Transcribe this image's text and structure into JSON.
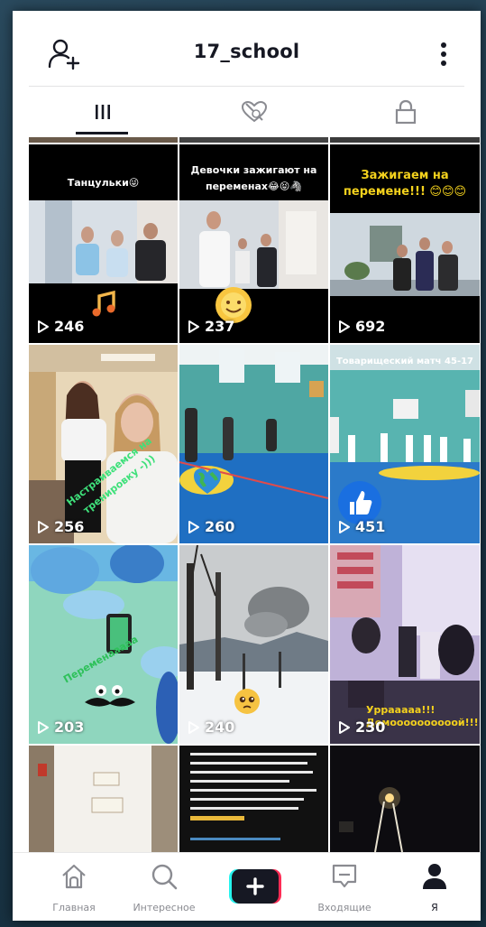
{
  "header": {
    "title": "17_school",
    "add_user_icon": "person-plus-icon",
    "more_icon": "vertical-dots-icon"
  },
  "tabs": [
    {
      "id": "videos",
      "icon": "grid-lines-icon",
      "active": true
    },
    {
      "id": "liked",
      "icon": "heart-hidden-icon",
      "active": false
    },
    {
      "id": "private",
      "icon": "lock-icon",
      "active": false
    }
  ],
  "videos": [
    {
      "views": "246",
      "caption": "Танцульки😜"
    },
    {
      "views": "237",
      "caption": "Девочки зажигают на переменах😂😝🦓"
    },
    {
      "views": "692",
      "caption": "Зажигаем на перемене!!! 😊😊😊"
    },
    {
      "views": "256",
      "caption": "Настраиваемся на тренировку -)))"
    },
    {
      "views": "260",
      "caption": ""
    },
    {
      "views": "451",
      "caption": "Товарищеский матч 45-17"
    },
    {
      "views": "203",
      "caption": "Переменааааа"
    },
    {
      "views": "240",
      "caption": ""
    },
    {
      "views": "230",
      "caption": "Уррааааа!!! Домоооооооооой!!!!!"
    },
    {
      "views": "",
      "caption": ""
    },
    {
      "views": "",
      "caption": ""
    },
    {
      "views": "",
      "caption": ""
    }
  ],
  "nav": {
    "home": "Главная",
    "discover": "Интересное",
    "inbox": "Входящие",
    "me": "Я"
  },
  "colors": {
    "accent_red": "#fe2c55",
    "accent_cyan": "#25f4ee",
    "text_primary": "#161823",
    "text_secondary": "#8a8b91"
  }
}
